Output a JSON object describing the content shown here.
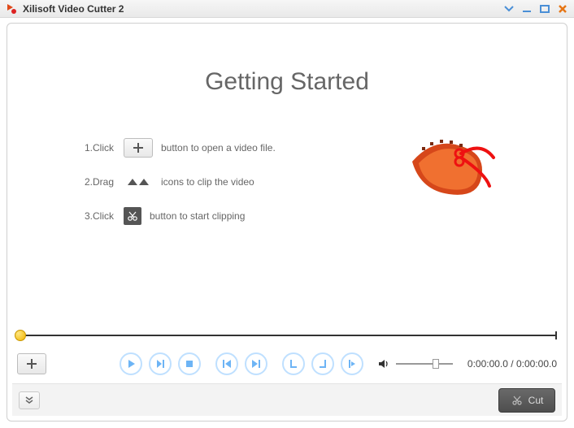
{
  "titlebar": {
    "app_title": "Xilisoft Video Cutter 2"
  },
  "getting_started": {
    "heading": "Getting Started",
    "step1_prefix": "1.Click",
    "step1_suffix": "button to open a video file.",
    "step2_prefix": "2.Drag",
    "step2_suffix": "icons to clip the video",
    "step3_prefix": "3.Click",
    "step3_suffix": "button to start clipping"
  },
  "player": {
    "time_current": "0:00:00.0",
    "time_separator": " / ",
    "time_total": "0:00:00.0"
  },
  "footer": {
    "cut_label": "Cut"
  },
  "icons": {
    "plus": "+",
    "play": "play-icon",
    "playclip": "play-clip-icon",
    "stop": "stop-icon",
    "prev": "prev-icon",
    "next": "next-icon",
    "markin": "mark-in-icon",
    "markout": "mark-out-icon",
    "goto": "goto-icon",
    "volume": "volume-icon",
    "expand": "expand-icon",
    "scissors": "scissors-icon",
    "dropdown": "dropdown-icon",
    "minimize": "minimize-icon",
    "maximize": "maximize-icon",
    "close": "close-icon"
  }
}
